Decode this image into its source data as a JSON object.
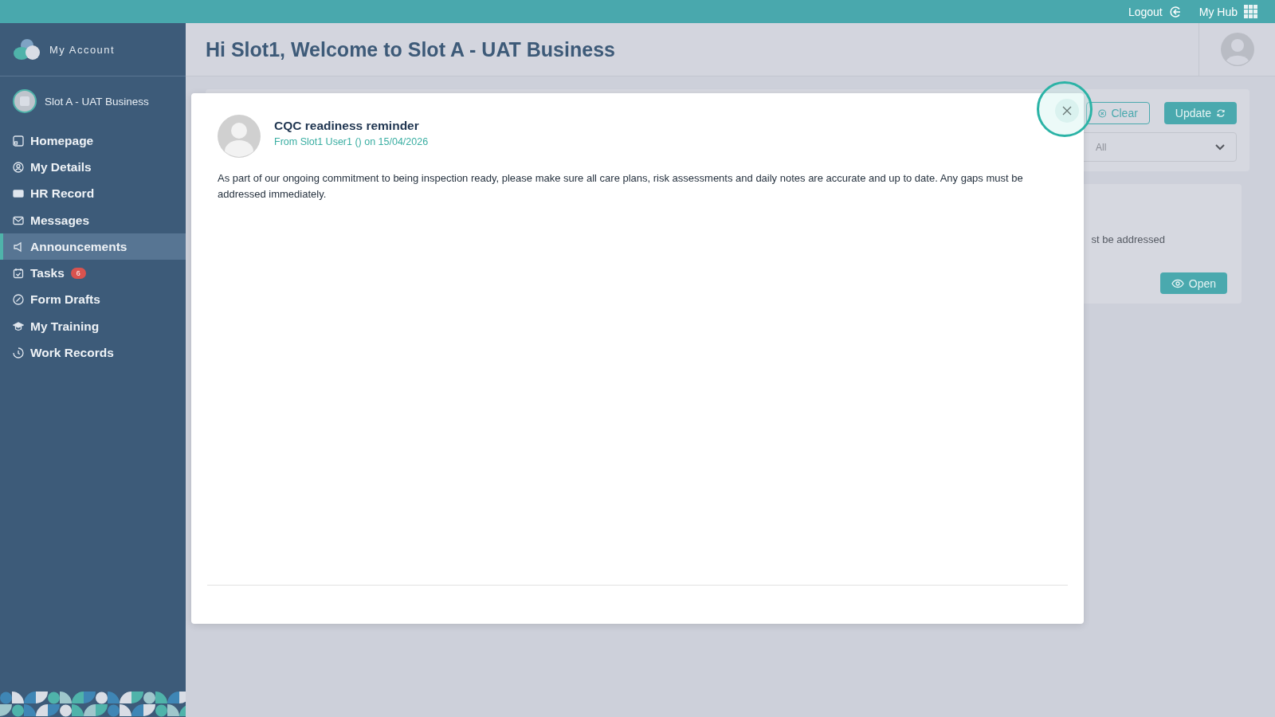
{
  "top_bar": {
    "logout": "Logout",
    "hub": "My Hub"
  },
  "sidebar": {
    "brand": "My Account",
    "business": "Slot A - UAT Business",
    "items": [
      {
        "label": "Homepage",
        "kind": "home",
        "selected": false
      },
      {
        "label": "My Details",
        "kind": "user",
        "selected": false
      },
      {
        "label": "HR Record",
        "kind": "card",
        "selected": false
      },
      {
        "label": "Messages",
        "kind": "mail",
        "selected": false
      },
      {
        "label": "Announcements",
        "kind": "megaphone",
        "selected": true
      },
      {
        "label": "Tasks",
        "kind": "calendar",
        "selected": false,
        "badge": "6"
      },
      {
        "label": "Form Drafts",
        "kind": "edit",
        "selected": false
      },
      {
        "label": "My Training",
        "kind": "cap",
        "selected": false
      },
      {
        "label": "Work Records",
        "kind": "clock",
        "selected": false
      }
    ]
  },
  "header": {
    "title": "Hi Slot1, Welcome to Slot A - UAT Business"
  },
  "filters": {
    "clear": "Clear",
    "update": "Update",
    "select_value": "All"
  },
  "announcement_card": {
    "excerpt": "st be addressed",
    "open": "Open"
  },
  "modal": {
    "title": "CQC readiness reminder",
    "meta": "From Slot1 User1 () on 15/04/2026",
    "body": "As part of our ongoing commitment to being inspection ready, please make sure all care plans, risk assessments and daily notes are accurate and up to date. Any gaps must be addressed immediately.",
    "close_highlighted": true
  }
}
